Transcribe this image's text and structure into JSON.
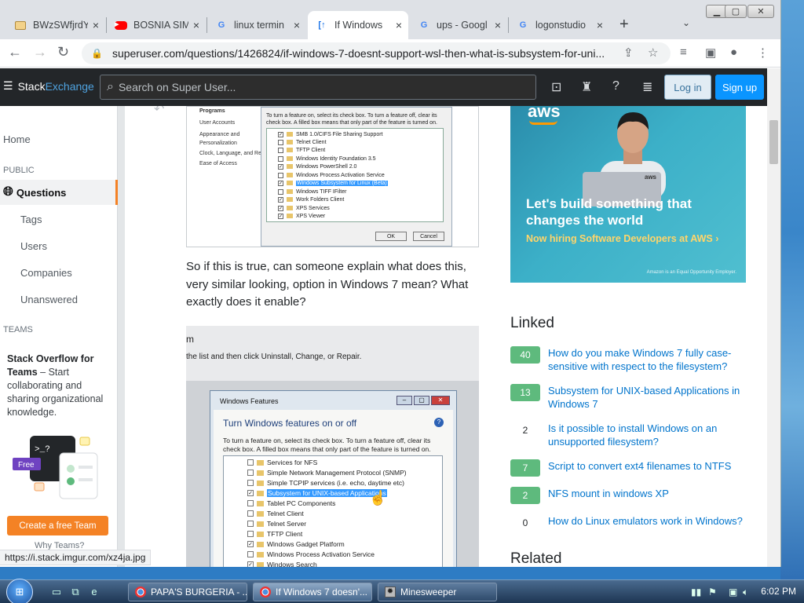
{
  "tabs": [
    {
      "label": "BWzSWfjrdY",
      "icon": "folder-icon",
      "close": "×"
    },
    {
      "label": "BOSNIA SIM",
      "icon": "youtube-icon",
      "close": "×"
    },
    {
      "label": "linux termin",
      "icon": "google-icon",
      "close": "×"
    },
    {
      "label": "If Windows",
      "icon": "stackexchange-icon",
      "close": "×"
    },
    {
      "label": "ups - Googl",
      "icon": "google-icon",
      "close": "×"
    },
    {
      "label": "logonstudio",
      "icon": "google-icon",
      "close": "×"
    }
  ],
  "newtab": "+",
  "tab_dropdown": "⌄",
  "window_controls": {
    "minimize": "▁",
    "maximize": "▢",
    "close": "✕"
  },
  "address": {
    "url": "superuser.com/questions/1426824/if-windows-7-doesnt-support-wsl-then-what-is-subsystem-for-uni...",
    "lock": "🔒"
  },
  "nav": {
    "back": "←",
    "forward": "→",
    "reload": "↻"
  },
  "toolbar_icons": {
    "share": "⇪",
    "bookmark": "☆",
    "media": "≡",
    "sidepanel": "▣",
    "profile": "●",
    "menu": "⋮"
  },
  "se_header": {
    "logo_a": "Stack",
    "logo_b": "Exchange",
    "search_placeholder": "Search on Super User...",
    "login": "Log in",
    "signup": "Sign up"
  },
  "leftnav": {
    "home": "Home",
    "public": "PUBLIC",
    "questions": "Questions",
    "tags": "Tags",
    "users": "Users",
    "companies": "Companies",
    "unanswered": "Unanswered",
    "teams": "TEAMS",
    "teams_title": "Stack Overflow for Teams",
    "teams_text": " – Start collaborating and sharing organizational knowledge.",
    "teams_prompt": ">_?",
    "teams_free": "Free",
    "create_team": "Create a free Team",
    "why_teams": "Why Teams?"
  },
  "screenshot1": {
    "side": [
      "Programs",
      "User Accounts",
      "Appearance and Personalization",
      "Clock, Language, and Re",
      "Ease of Access"
    ],
    "hint": "To turn a feature on, select its check box. To turn a feature off, clear its check box. A filled box means that only part of the feature is turned on.",
    "items": [
      {
        "label": "SMB 1.0/CIFS File Sharing Support",
        "checked": "✓",
        "selected": false
      },
      {
        "label": "Telnet Client",
        "checked": "",
        "selected": false
      },
      {
        "label": "TFTP Client",
        "checked": "",
        "selected": false
      },
      {
        "label": "Windows Identity Foundation 3.5",
        "checked": "",
        "selected": false
      },
      {
        "label": "Windows PowerShell 2.0",
        "checked": "✓",
        "selected": false
      },
      {
        "label": "Windows Process Activation Service",
        "checked": "",
        "selected": false
      },
      {
        "label": "Windows Subsystem for Linux (Beta)",
        "checked": "✓",
        "selected": true
      },
      {
        "label": "Windows TIFF IFilter",
        "checked": "",
        "selected": false
      },
      {
        "label": "Work Folders Client",
        "checked": "✓",
        "selected": false
      },
      {
        "label": "XPS Services",
        "checked": "✓",
        "selected": false
      },
      {
        "label": "XPS Viewer",
        "checked": "✓",
        "selected": false
      }
    ],
    "ok": "OK",
    "cancel": "Cancel"
  },
  "paragraph": "So if this is true, can someone explain what does this, very similar looking, option in Windows 7 mean? What exactly does it enable?",
  "screenshot2": {
    "line1": "m",
    "line2": "the list and then click Uninstall, Change, or Repair.",
    "title": "Windows Features",
    "heading": "Turn Windows features on or off",
    "hint": "To turn a feature on, select its check box. To turn a feature off, clear its check box. A filled box means that only part of the feature is turned on.",
    "items": [
      {
        "label": "Services for NFS",
        "checked": "",
        "selected": false
      },
      {
        "label": "Simple Network Management Protocol (SNMP)",
        "checked": "",
        "selected": false
      },
      {
        "label": "Simple TCPIP services (i.e. echo, daytime etc)",
        "checked": "",
        "selected": false
      },
      {
        "label": "Subsystem for UNIX-based Applications",
        "checked": "✓",
        "selected": true
      },
      {
        "label": "Tablet PC Components",
        "checked": "",
        "selected": false
      },
      {
        "label": "Telnet Client",
        "checked": "",
        "selected": false
      },
      {
        "label": "Telnet Server",
        "checked": "",
        "selected": false
      },
      {
        "label": "TFTP Client",
        "checked": "",
        "selected": false
      },
      {
        "label": "Windows Gadget Platform",
        "checked": "✓",
        "selected": false
      },
      {
        "label": "Windows Process Activation Service",
        "checked": "",
        "selected": false
      },
      {
        "label": "Windows Search",
        "checked": "✓",
        "selected": false
      }
    ]
  },
  "ad": {
    "brand": "aws",
    "headline": "Let's build something that changes the world",
    "sub": "Now hiring Software Developers at AWS ›",
    "fine": "Amazon is an Equal Opportunity Employer.",
    "laptop_sticker": "aws"
  },
  "linked": {
    "heading": "Linked",
    "items": [
      {
        "count": "40",
        "accepted": true,
        "title": "How do you make Windows 7 fully case-sensitive with respect to the filesystem?"
      },
      {
        "count": "13",
        "accepted": true,
        "title": "Subsystem for UNIX-based Applications in Windows 7"
      },
      {
        "count": "2",
        "accepted": false,
        "title": "Is it possible to install Windows on an unsupported filesystem?"
      },
      {
        "count": "7",
        "accepted": true,
        "title": "Script to convert ext4 filenames to NTFS"
      },
      {
        "count": "2",
        "accepted": true,
        "title": "NFS mount in windows XP"
      },
      {
        "count": "0",
        "accepted": false,
        "title": "How do Linux emulators work in Windows?"
      }
    ]
  },
  "related_heading": "Related",
  "status_url": "https://i.stack.imgur.com/xz4ja.jpg",
  "taskbar": {
    "tasks": [
      {
        "label": "PAPA'S BURGERIA - ...",
        "icon": "chrome-icon",
        "active": false
      },
      {
        "label": "If Windows 7 doesn'...",
        "icon": "chrome-icon",
        "active": true
      },
      {
        "label": "Minesweeper",
        "icon": "minesweeper-icon",
        "active": false
      }
    ],
    "clock": "6:02 PM"
  }
}
